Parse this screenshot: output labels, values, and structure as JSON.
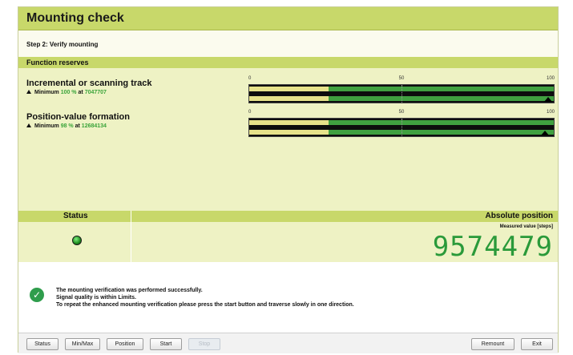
{
  "window": {
    "title": "Mounting check"
  },
  "step": {
    "label": "Step 2: Verify mounting"
  },
  "function_reserves": {
    "heading": "Function reserves",
    "scale_labels": [
      "0",
      "50",
      "100"
    ],
    "tracks": [
      {
        "name": "Incremental or scanning track",
        "minimum_label": "Minimum",
        "minimum_value": "100 %",
        "at_label": "at",
        "at_position": "7047707",
        "top_yellow_fraction": 0.26,
        "bottom_yellow_fraction": 0.26
      },
      {
        "name": "Position-value formation",
        "minimum_label": "Minimum",
        "minimum_value": "98 %",
        "at_label": "at",
        "at_position": "12684134",
        "top_yellow_fraction": 0.26,
        "bottom_yellow_fraction": 0.26
      }
    ]
  },
  "status": {
    "heading": "Status",
    "led_color": "#2a9a3a"
  },
  "absolute_position": {
    "heading": "Absolute position",
    "caption": "Measured value [steps]",
    "value": "9574479"
  },
  "messages": {
    "lines": [
      "The mounting verification was performed successfully.",
      "Signal quality is within Limits.",
      "To repeat the enhanced mounting verification please press the start button and traverse slowly in one direction."
    ],
    "icon": "check-circle-icon"
  },
  "buttons": {
    "status": "Status",
    "minmax": "Min/Max",
    "position": "Position",
    "start": "Start",
    "stop": "Stop",
    "remount": "Remount",
    "exit": "Exit"
  },
  "colors": {
    "header_green": "#c8d86a",
    "panel_bg": "#eef2c4",
    "bar_green": "#40a040",
    "bar_yellow": "#e6e28a",
    "value_green": "#2a9a3a"
  }
}
